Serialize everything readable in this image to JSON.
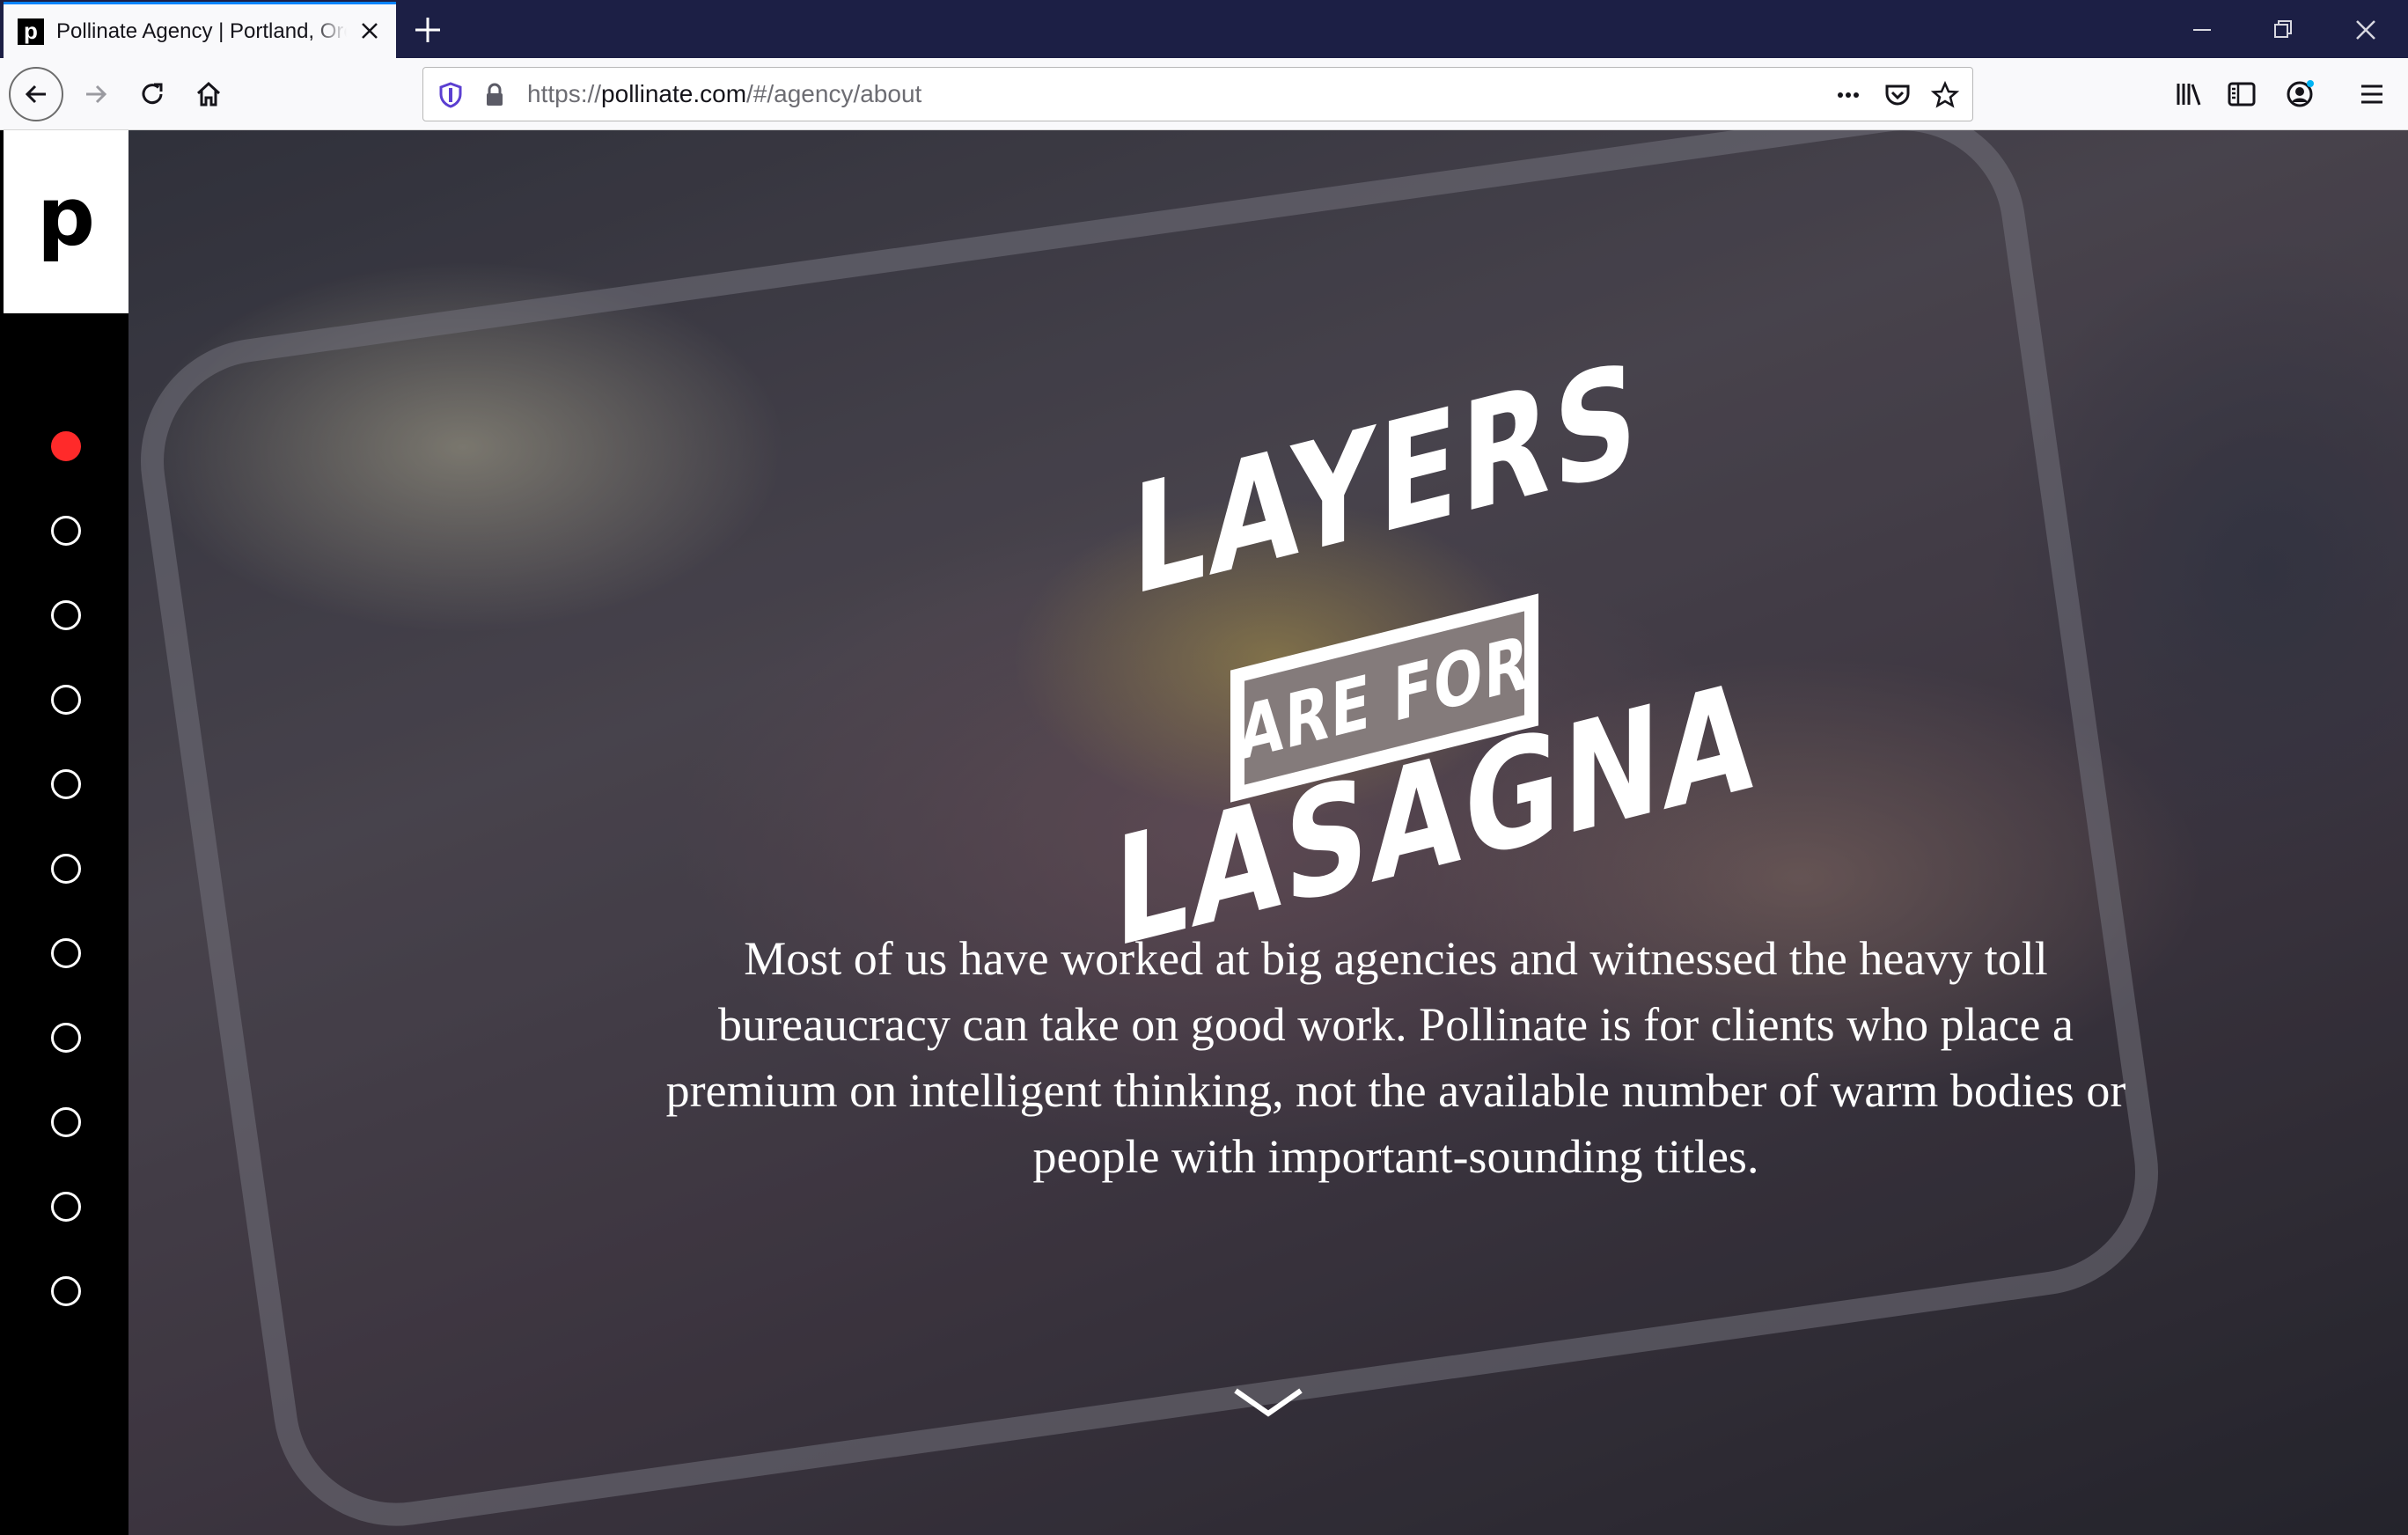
{
  "browser": {
    "tab": {
      "title": "Pollinate Agency | Portland, Ore",
      "favicon_letter": "p"
    },
    "url": {
      "prefix": "https://",
      "host": "pollinate.com",
      "path": "/#/agency/about"
    },
    "icons": [
      "back-icon",
      "forward-icon",
      "reload-icon",
      "home-icon",
      "shield-icon",
      "lock-icon",
      "more-icon",
      "pocket-icon",
      "star-icon",
      "library-icon",
      "sidebar-icon",
      "account-icon",
      "menu-icon"
    ]
  },
  "sidebar": {
    "logo": "p",
    "sections": 11,
    "active_index": 0,
    "accent": "#ff2a2a"
  },
  "hero": {
    "headline": {
      "line1": "LAYERS",
      "line2": "ARE FOR",
      "line3": "LASAGNA"
    },
    "body": "Most of us have worked at big agencies and witnessed the heavy toll bureaucracy can take on good work. Pollinate is for clients who place a premium on intelligent thinking, not the available number of warm bodies or people with important-sounding titles.",
    "scroll_icon": "chevron-down-icon"
  }
}
